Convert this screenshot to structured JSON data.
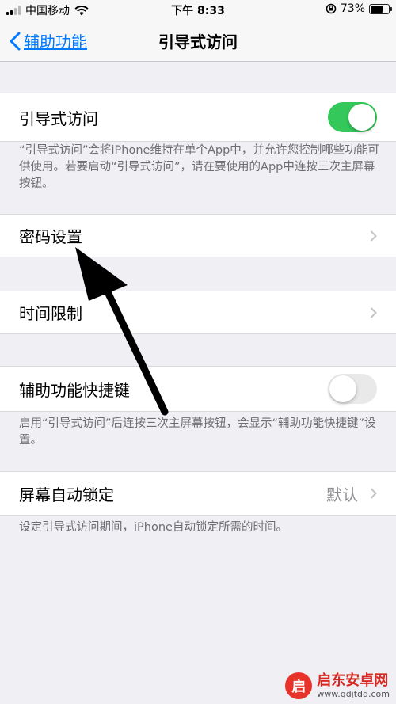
{
  "status": {
    "carrier": "中国移动",
    "time": "下午 8:33",
    "battery": "73%",
    "battery_level": 0.73
  },
  "nav": {
    "back_label": "辅助功能",
    "title": "引导式访问"
  },
  "guided_access": {
    "label": "引导式访问",
    "enabled": true,
    "footnote": "“引导式访问”会将iPhone维持在单个App中，并允许您控制哪些功能可供使用。若要启动“引导式访问”，请在要使用的App中连按三次主屏幕按钮。"
  },
  "passcode": {
    "label": "密码设置"
  },
  "time_limits": {
    "label": "时间限制"
  },
  "accessibility_shortcut": {
    "label": "辅助功能快捷键",
    "enabled": false,
    "footnote": "启用“引导式访问”后连按三次主屏幕按钮，会显示“辅助功能快捷键”设置。"
  },
  "auto_lock": {
    "label": "屏幕自动锁定",
    "value": "默认",
    "footnote": "设定引导式访问期间，iPhone自动锁定所需的时间。"
  },
  "watermark": {
    "title": "启东安卓网",
    "url": "www.qdjtdq.com"
  },
  "colors": {
    "accent": "#007aff",
    "toggle_on": "#34c759",
    "background": "#efeff4"
  }
}
